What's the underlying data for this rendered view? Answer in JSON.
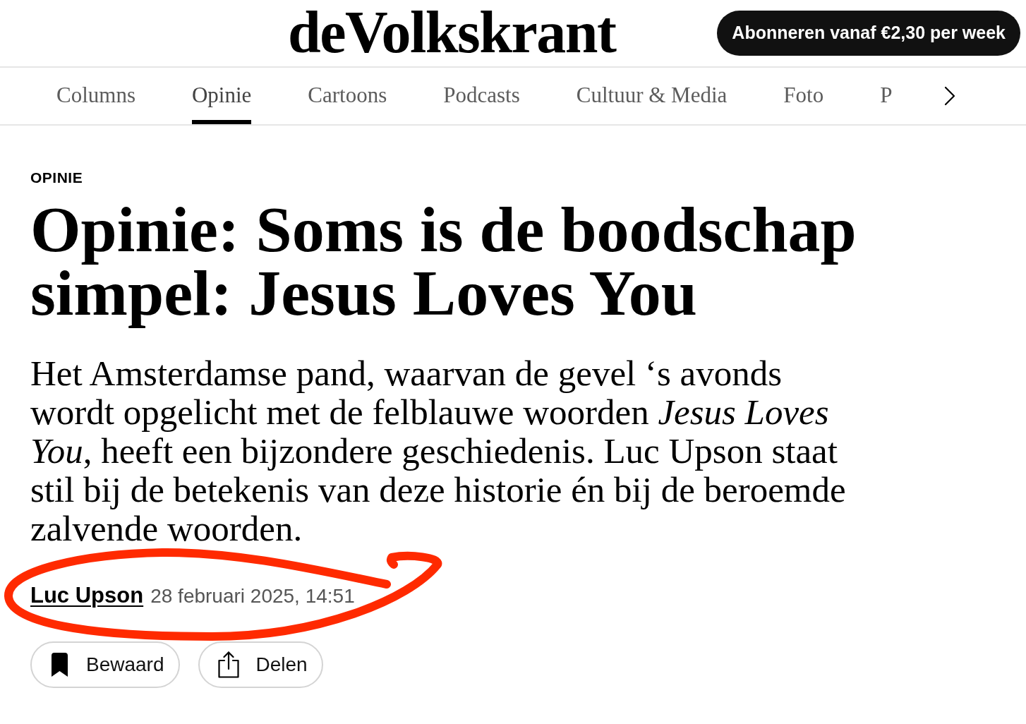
{
  "header": {
    "logo": "deVolkskrant",
    "subscribe_button": "Abonneren vanaf €2,30 per week"
  },
  "nav": {
    "tabs": [
      {
        "label": "Columns",
        "selected": false
      },
      {
        "label": "Opinie",
        "selected": true
      },
      {
        "label": "Cartoons",
        "selected": false
      },
      {
        "label": "Podcasts",
        "selected": false
      },
      {
        "label": "Cultuur & Media",
        "selected": false
      },
      {
        "label": "Foto",
        "selected": false
      },
      {
        "label": "P",
        "selected": false
      }
    ]
  },
  "article": {
    "section_label": "OPINIE",
    "headline": "Opinie: Soms is de boodschap simpel: Jesus Loves You",
    "lead": "Het Amsterdamse pand, waarvan de gevel ‘s avonds wordt opgelicht met de felblauwe woorden *Jesus Loves You*, heeft een bijzondere geschiedenis. Luc Upson staat stil bij de betekenis van deze historie én bij de beroemde zalvende woorden.",
    "author": "Luc Upson",
    "date": "28 februari 2025, 14:51",
    "actions": [
      {
        "kind": "bookmark",
        "label": "Bewaard"
      },
      {
        "kind": "share",
        "label": "Delen"
      }
    ]
  }
}
